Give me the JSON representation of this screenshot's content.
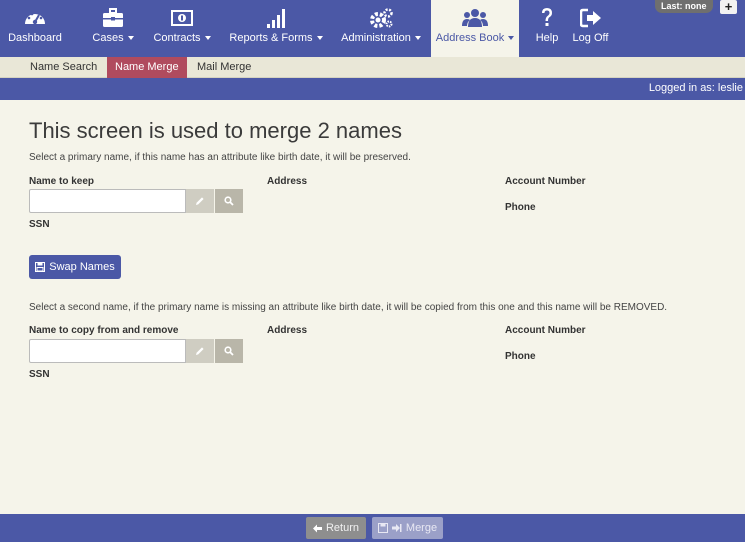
{
  "nav": {
    "items": [
      {
        "label": "Dashboard",
        "icon": "dashboard-icon",
        "caret": false
      },
      {
        "label": "Cases",
        "icon": "briefcase-icon",
        "caret": true
      },
      {
        "label": "Contracts",
        "icon": "money-icon",
        "caret": true
      },
      {
        "label": "Reports & Forms",
        "icon": "bar-chart-icon",
        "caret": true
      },
      {
        "label": "Administration",
        "icon": "gears-icon",
        "caret": true
      },
      {
        "label": "Address Book",
        "icon": "users-icon",
        "caret": true,
        "active": true
      },
      {
        "label": "Help",
        "icon": "question-icon",
        "caret": false
      },
      {
        "label": "Log Off",
        "icon": "sign-out-icon",
        "caret": false
      }
    ],
    "last_badge": "Last: none",
    "plus": "+"
  },
  "subnav": {
    "tabs": [
      "Name Search",
      "Name Merge",
      "Mail Merge"
    ],
    "active": "Name Merge"
  },
  "logged_in": "Logged in as: leslie",
  "main": {
    "title": "This screen is used to merge 2 names",
    "primary": {
      "instruction": "Select a primary name, if this name has an attribute like birth date, it will be preserved.",
      "name_label": "Name to keep",
      "address_label": "Address",
      "account_label": "Account Number",
      "phone_label": "Phone",
      "ssn_label": "SSN",
      "value": ""
    },
    "swap_label": "Swap Names",
    "secondary": {
      "instruction": "Select a second name, if the primary name is missing an attribute like birth date, it will be copied from this one and this name will be REMOVED.",
      "name_label": "Name to copy from and remove",
      "address_label": "Address",
      "account_label": "Account Number",
      "phone_label": "Phone",
      "ssn_label": "SSN",
      "value": ""
    }
  },
  "footer": {
    "return_label": "Return",
    "merge_label": "Merge"
  },
  "colors": {
    "nav_bg": "#4b58a6",
    "page_bg": "#f5f4ea",
    "active_tab": "#b04b5e"
  }
}
